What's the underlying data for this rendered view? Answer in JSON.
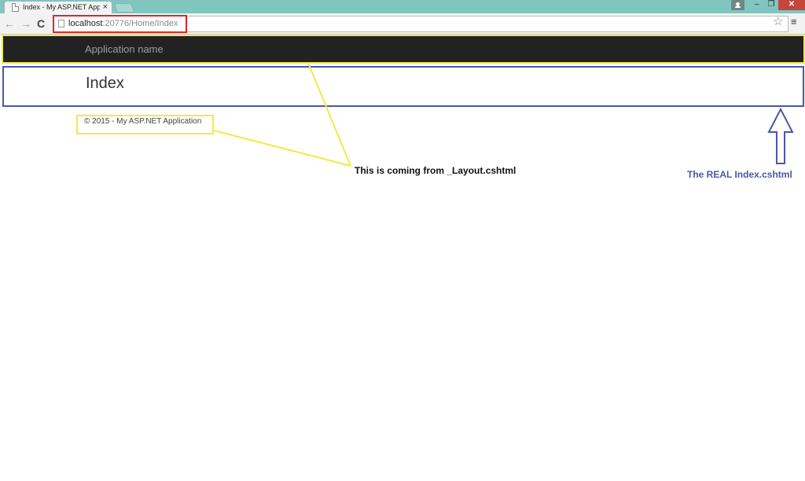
{
  "browser": {
    "tab_title": "Index - My ASP.NET Appli",
    "tab_close": "×",
    "window_controls": {
      "minimize": "–",
      "maximize": "❐",
      "close": "✕"
    },
    "nav": {
      "back": "←",
      "forward": "→",
      "reload": "C"
    },
    "url_host": "localhost",
    "url_path": ":20776/Home/Index",
    "bookmark_star": "☆",
    "menu": "≡"
  },
  "page": {
    "brand": "Application name",
    "heading": "Index",
    "footer": "© 2015 - My ASP.NET Application"
  },
  "annotations": {
    "layout_note": "This is coming from _Layout.cshtml",
    "index_note": "The REAL Index.cshtml"
  },
  "colors": {
    "layout_highlight": "#f2e94a",
    "index_highlight": "#4a57a6",
    "url_highlight": "#e3232c",
    "navbar_bg": "#222222",
    "titlebar_bg": "#7fc6bf"
  }
}
